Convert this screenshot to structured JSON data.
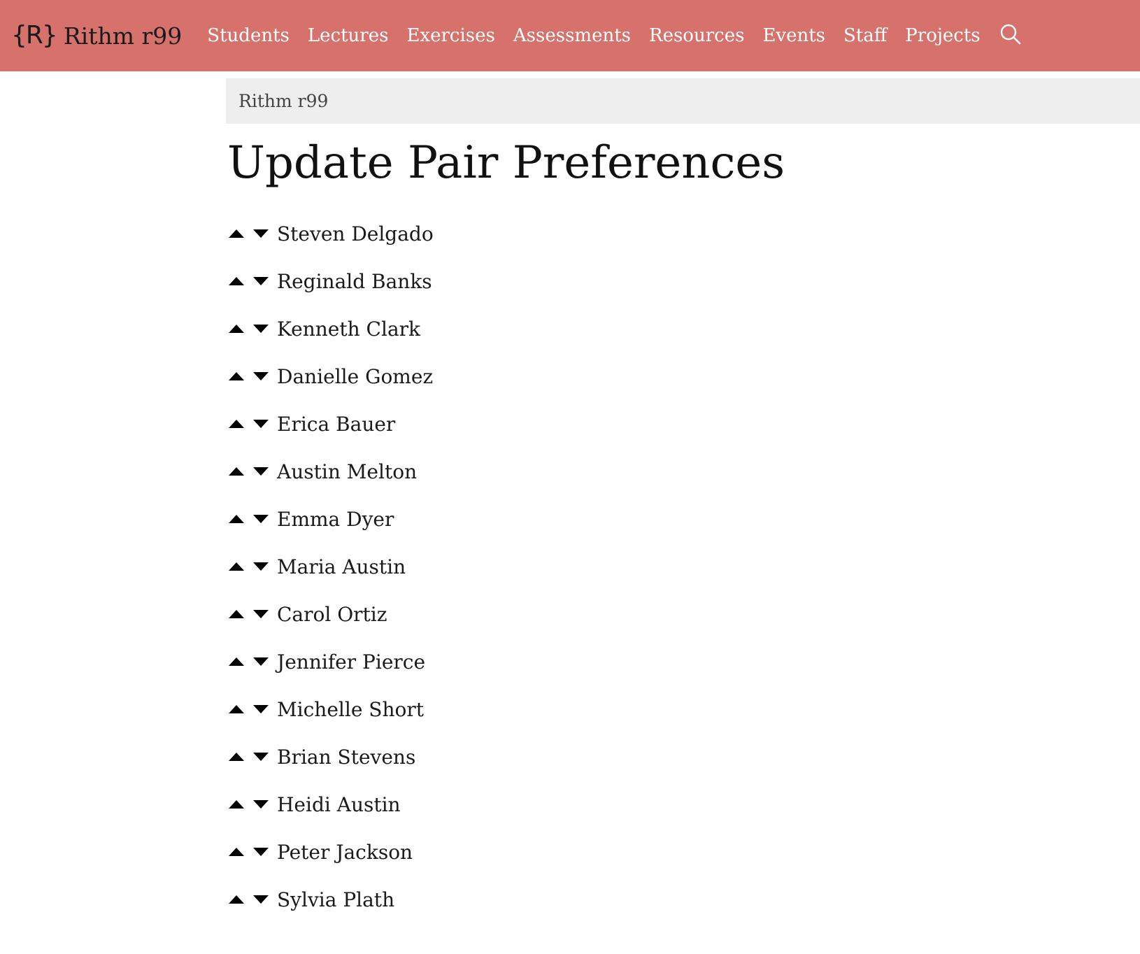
{
  "navbar": {
    "brand_mark": "{R}",
    "brand_name": "Rithm r99",
    "links": [
      {
        "label": "Students"
      },
      {
        "label": "Lectures"
      },
      {
        "label": "Exercises"
      },
      {
        "label": "Assessments"
      },
      {
        "label": "Resources"
      },
      {
        "label": "Events"
      },
      {
        "label": "Staff"
      },
      {
        "label": "Projects"
      }
    ],
    "search_icon": "search-icon",
    "background_color": "#d6726b"
  },
  "breadcrumb": {
    "items": [
      {
        "label": "Rithm r99"
      }
    ]
  },
  "page": {
    "title": "Update Pair Preferences"
  },
  "preferences": [
    {
      "name": "Steven Delgado"
    },
    {
      "name": "Reginald Banks"
    },
    {
      "name": "Kenneth Clark"
    },
    {
      "name": "Danielle Gomez"
    },
    {
      "name": "Erica Bauer"
    },
    {
      "name": "Austin Melton"
    },
    {
      "name": "Emma Dyer"
    },
    {
      "name": "Maria Austin"
    },
    {
      "name": "Carol Ortiz"
    },
    {
      "name": "Jennifer Pierce"
    },
    {
      "name": "Michelle Short"
    },
    {
      "name": "Brian Stevens"
    },
    {
      "name": "Heidi Austin"
    },
    {
      "name": "Peter Jackson"
    },
    {
      "name": "Sylvia Plath"
    }
  ],
  "icons": {
    "move_up": "caret-up-icon",
    "move_down": "caret-down-icon"
  }
}
